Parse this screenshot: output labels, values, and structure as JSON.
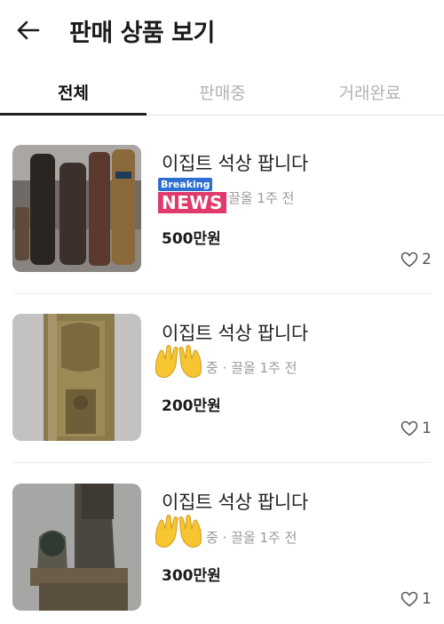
{
  "header": {
    "title": "판매 상품 보기",
    "back_icon": "arrow-left-icon"
  },
  "tabs": [
    {
      "label": "전체",
      "active": true
    },
    {
      "label": "판매중",
      "active": false
    },
    {
      "label": "거래완료",
      "active": false
    }
  ],
  "items": [
    {
      "title": "이집트 석상 팝니다",
      "meta": "끌올 1주 전",
      "price": "500만원",
      "likes": "2",
      "overlay": "Breaking NEWS"
    },
    {
      "title": "이집트 석상 팝니다",
      "meta": "중 · 끌올 1주 전",
      "price": "200만원",
      "likes": "1"
    },
    {
      "title": "이집트 석상 팝니다",
      "meta": "중 · 끌올 1주 전",
      "price": "300만원",
      "likes": "1"
    }
  ],
  "overlay": {
    "news_top": "Breaking",
    "news_main": "NEWS"
  },
  "colors": {
    "accent": "#222222",
    "inactive_tab": "#b3b3b3",
    "meta": "#9a9a9a",
    "news_blue": "#2d6fd0",
    "news_pink": "#e03a6c"
  }
}
